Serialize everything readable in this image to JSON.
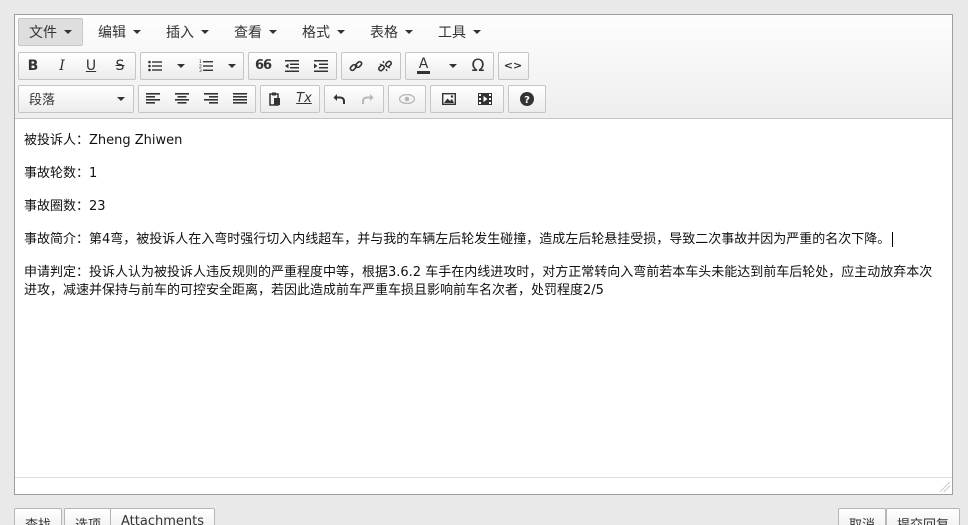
{
  "menubar": {
    "items": [
      "文件",
      "编辑",
      "插入",
      "查看",
      "格式",
      "表格",
      "工具"
    ]
  },
  "toolbar": {
    "bold": "B",
    "italic": "I",
    "underline": "U",
    "strikethrough": "S",
    "quote": "66",
    "omega": "Ω",
    "code": "<>",
    "font_color": "A",
    "clear_format": "Tx",
    "block_format": "段落"
  },
  "content": {
    "lines": [
      "被投诉人：Zheng Zhiwen",
      "事故轮数：1",
      "事故圈数：23",
      "事故简介：第4弯，被投诉人在入弯时强行切入内线超车，并与我的车辆左后轮发生碰撞，造成左后轮悬挂受损，导致二次事故并因为严重的名次下降。",
      "申请判定：投诉人认为被投诉人违反规则的严重程度中等，根据3.6.2 车手在内线进攻时，对方正常转向入弯前若本车头未能达到前车后轮处，应主动放弃本次进攻，减速并保持与前车的可控安全距离，若因此造成前车严重车损且影响前车名次者，处罚程度2/5"
    ]
  },
  "bottom": {
    "left_buttons": [
      "查找",
      "选项",
      "Attachments"
    ],
    "right_buttons": [
      "取消",
      "提交回复"
    ]
  },
  "colors": {
    "page_bg": "#e9e9e9",
    "toolbar_bg": "#f4f4f4",
    "border": "#9e9e9e"
  }
}
